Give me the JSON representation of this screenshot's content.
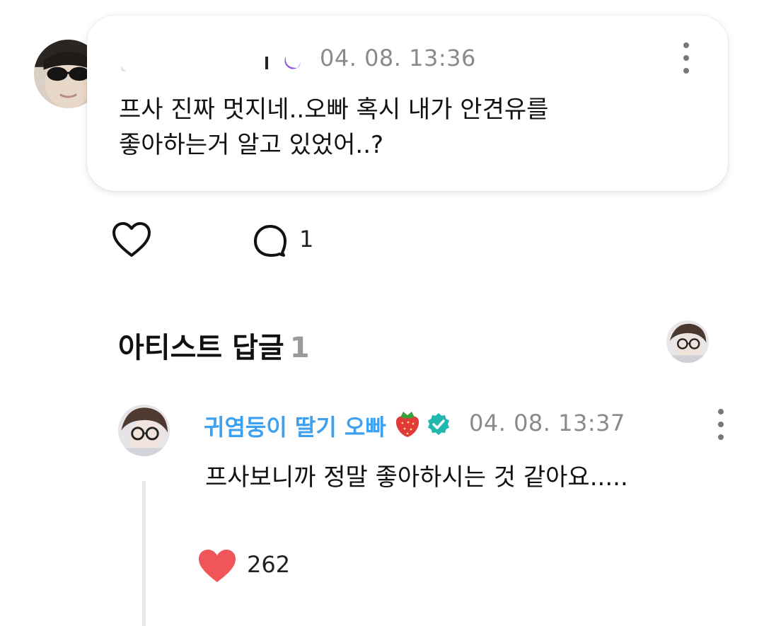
{
  "fan_comment": {
    "timestamp": "04. 08. 13:36",
    "lines": [
      "프사 진짜 멋지네..오빠 혹시 내가 안견유를",
      "좋아하는거 알고 있었어..?"
    ],
    "reply_count": "1",
    "icons": {
      "more": "more-vertical-icon",
      "like": "heart-outline-icon",
      "reply": "comment-bubble-icon",
      "badge": "crescent-moon-icon"
    }
  },
  "artist_section": {
    "title": "아티스트 답글",
    "count": "1"
  },
  "artist_reply": {
    "name": "귀염둥이 딸기 오빠",
    "timestamp": "04. 08. 13:37",
    "text": "프사보니까 정말 좋아하시는 것 같아요.....",
    "like_count": "262",
    "icons": {
      "emoji": "strawberry-icon",
      "verified": "verified-badge-icon",
      "like": "heart-filled-icon",
      "more": "more-vertical-icon"
    }
  },
  "colors": {
    "artist_name": "#3da0f0",
    "verified": "#22b8b0",
    "heart": "#f0555a",
    "timestamp": "#8a8a8a"
  }
}
